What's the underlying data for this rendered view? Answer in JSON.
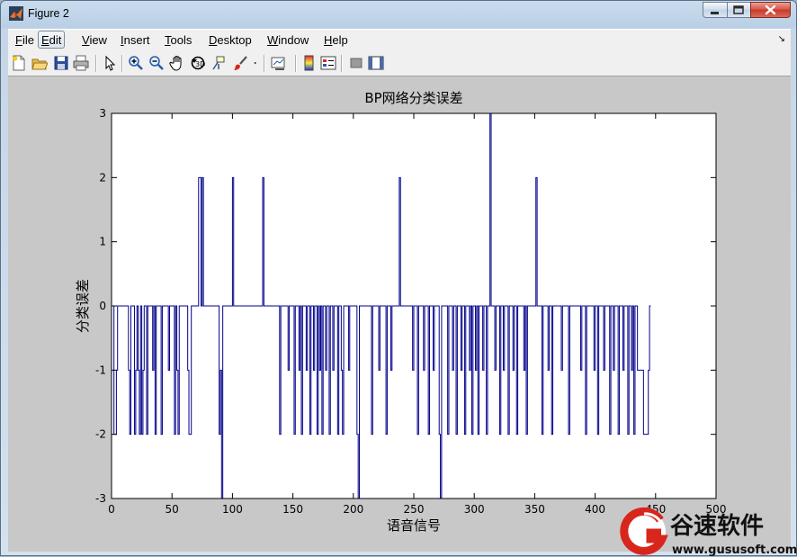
{
  "window": {
    "title": "Figure 2"
  },
  "menu": [
    {
      "id": "file",
      "label": "File",
      "u": "F",
      "rest": "ile"
    },
    {
      "id": "edit",
      "label": "Edit",
      "u": "E",
      "rest": "dit"
    },
    {
      "id": "view",
      "label": "View",
      "u": "V",
      "rest": "iew"
    },
    {
      "id": "insert",
      "label": "Insert",
      "u": "I",
      "rest": "nsert"
    },
    {
      "id": "tools",
      "label": "Tools",
      "u": "T",
      "rest": "ools"
    },
    {
      "id": "desktop",
      "label": "Desktop",
      "u": "D",
      "rest": "esktop"
    },
    {
      "id": "window",
      "label": "Window",
      "u": "W",
      "rest": "indow"
    },
    {
      "id": "help",
      "label": "Help",
      "u": "H",
      "rest": "elp"
    }
  ],
  "toolbar_icons": [
    "new-figure-icon",
    "open-file-icon",
    "save-icon",
    "print-icon",
    "pointer-icon",
    "zoom-in-icon",
    "zoom-out-icon",
    "pan-icon",
    "rotate-3d-icon",
    "data-cursor-icon",
    "brush-icon",
    "brush-dropdown-icon",
    "link-plot-icon",
    "colorbar-icon",
    "legend-icon",
    "hide-plot-tools-icon",
    "show-plot-tools-icon"
  ],
  "colors": {
    "line": "#00008b",
    "figure_bg": "#c8c8c8"
  },
  "logo": {
    "name": "谷速软件",
    "url": "www.gususoft.com"
  },
  "chart_data": {
    "type": "line",
    "title": "BP网络分类误差",
    "xlabel": "语音信号",
    "ylabel": "分类误差",
    "xlim": [
      0,
      500
    ],
    "ylim": [
      -3,
      3
    ],
    "xticks": [
      0,
      50,
      100,
      150,
      200,
      250,
      300,
      350,
      400,
      450,
      500
    ],
    "yticks": [
      -3,
      -2,
      -1,
      0,
      1,
      2,
      3
    ],
    "grid": false,
    "series": [
      {
        "values": [
          0,
          -2,
          -2,
          -1,
          0,
          0,
          0,
          0,
          0,
          0,
          0,
          0,
          0,
          -1,
          -2,
          0,
          0,
          0,
          -2,
          -1,
          0,
          -1,
          -2,
          0,
          -2,
          -1,
          0,
          0,
          -2,
          0,
          0,
          0,
          0,
          -1,
          0,
          -2,
          0,
          0,
          0,
          0,
          -2,
          0,
          0,
          0,
          0,
          0,
          -1,
          0,
          0,
          0,
          0,
          -2,
          0,
          -1,
          -2,
          0,
          0,
          0,
          0,
          0,
          0,
          0,
          -1,
          -2,
          -2,
          0,
          0,
          0,
          0,
          0,
          0,
          2,
          2,
          0,
          2,
          0,
          0,
          0,
          0,
          0,
          0,
          0,
          0,
          0,
          0,
          0,
          0,
          0,
          -2,
          -1,
          -3,
          0,
          0,
          0,
          0,
          0,
          0,
          0,
          0,
          2,
          0,
          0,
          0,
          0,
          0,
          0,
          0,
          0,
          0,
          0,
          0,
          0,
          0,
          0,
          0,
          0,
          0,
          0,
          0,
          0,
          0,
          0,
          0,
          0,
          2,
          0,
          0,
          0,
          0,
          0,
          0,
          0,
          0,
          0,
          0,
          0,
          0,
          0,
          -2,
          0,
          0,
          0,
          0,
          0,
          0,
          -1,
          0,
          0,
          0,
          0,
          -2,
          0,
          0,
          0,
          -1,
          0,
          -2,
          0,
          0,
          0,
          -1,
          0,
          0,
          -2,
          0,
          0,
          -1,
          0,
          0,
          -2,
          0,
          -1,
          0,
          -2,
          0,
          0,
          -1,
          0,
          0,
          -2,
          0,
          0,
          -1,
          0,
          0,
          0,
          -2,
          0,
          0,
          -1,
          -2,
          0,
          0,
          0,
          0,
          -1,
          0,
          0,
          0,
          0,
          0,
          0,
          -2,
          -3,
          0,
          0,
          0,
          0,
          0,
          0,
          0,
          0,
          0,
          0,
          -2,
          0,
          0,
          0,
          0,
          0,
          -1,
          0,
          0,
          0,
          0,
          0,
          -2,
          0,
          0,
          0,
          -1,
          0,
          0,
          0,
          0,
          0,
          0,
          2,
          0,
          0,
          0,
          0,
          0,
          0,
          0,
          0,
          0,
          0,
          -1,
          0,
          0,
          0,
          -2,
          0,
          0,
          0,
          0,
          -1,
          0,
          0,
          0,
          -2,
          0,
          0,
          0,
          -1,
          0,
          0,
          0,
          0,
          -2,
          -3,
          0,
          0,
          0,
          0,
          0,
          -2,
          0,
          0,
          0,
          -1,
          0,
          0,
          -2,
          0,
          0,
          0,
          -1,
          0,
          0,
          -2,
          0,
          0,
          0,
          -1,
          0,
          -2,
          0,
          0,
          -1,
          0,
          -2,
          0,
          0,
          0,
          -1,
          0,
          0,
          -2,
          0,
          0,
          3,
          0,
          0,
          0,
          -1,
          0,
          0,
          0,
          -2,
          0,
          0,
          -1,
          0,
          0,
          0,
          -2,
          0,
          0,
          0,
          -1,
          0,
          0,
          -2,
          0,
          0,
          0,
          0,
          0,
          -1,
          0,
          -2,
          0,
          0,
          0,
          0,
          0,
          0,
          0,
          2,
          0,
          0,
          0,
          0,
          -2,
          0,
          0,
          0,
          0,
          -1,
          0,
          0,
          -2,
          0,
          0,
          0,
          0,
          0,
          0,
          0,
          -1,
          0,
          0,
          0,
          0,
          0,
          -2,
          0,
          0,
          0,
          0,
          0,
          0,
          0,
          0,
          0,
          -1,
          0,
          0,
          0,
          -2,
          0,
          0,
          0,
          0,
          0,
          0,
          -1,
          0,
          0,
          -2,
          0,
          0,
          0,
          0,
          -1,
          0,
          0,
          0,
          0,
          -2,
          0,
          0,
          -1,
          0,
          0,
          0,
          -2,
          0,
          0,
          0,
          -1,
          0,
          0,
          0,
          -2,
          0,
          0,
          -1,
          0,
          -2,
          0,
          0,
          -1,
          -1,
          -1,
          -1,
          -1,
          -2,
          -2,
          -2,
          -2,
          -1,
          0
        ]
      }
    ]
  }
}
